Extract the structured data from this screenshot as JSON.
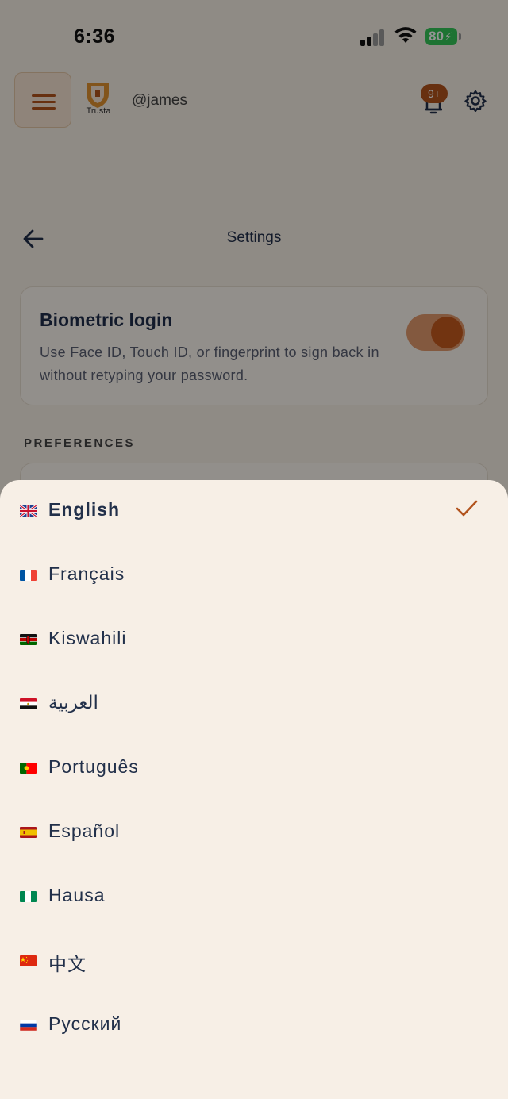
{
  "status_bar": {
    "time": "6:36",
    "battery": "80"
  },
  "header": {
    "brand": "Trusta",
    "username": "@james",
    "notification_badge": "9+"
  },
  "settings": {
    "title": "Settings"
  },
  "biometric": {
    "title": "Biometric login",
    "description": "Use Face ID, Touch ID, or fingerprint to sign back in without retyping your password.",
    "enabled": true
  },
  "preferences": {
    "label": "PREFERENCES"
  },
  "languages": [
    {
      "label": "English",
      "flag": "uk-flag-icon",
      "selected": true
    },
    {
      "label": "Français",
      "flag": "france-flag-icon",
      "selected": false
    },
    {
      "label": "Kiswahili",
      "flag": "kenya-flag-icon",
      "selected": false
    },
    {
      "label": "العربية",
      "flag": "egypt-flag-icon",
      "selected": false
    },
    {
      "label": "Português",
      "flag": "portugal-flag-icon",
      "selected": false
    },
    {
      "label": "Español",
      "flag": "spain-flag-icon",
      "selected": false
    },
    {
      "label": "Hausa",
      "flag": "nigeria-flag-icon",
      "selected": false
    },
    {
      "label": "中文",
      "flag": "china-flag-icon",
      "selected": false
    },
    {
      "label": "Русский",
      "flag": "russia-flag-icon",
      "selected": false
    }
  ],
  "colors": {
    "accent": "#b2531d",
    "background": "#f7efe6",
    "text": "#22304a"
  }
}
